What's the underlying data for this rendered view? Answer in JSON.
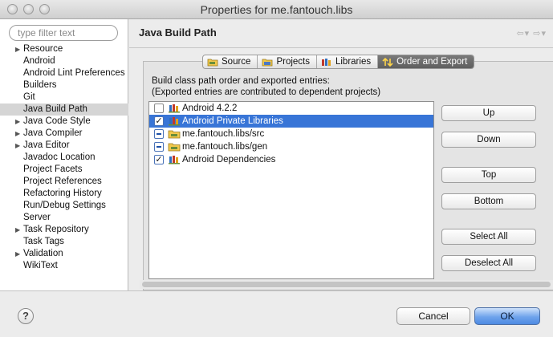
{
  "window": {
    "title": "Properties for me.fantouch.libs"
  },
  "sidebar": {
    "filter_placeholder": "type filter text",
    "items": [
      {
        "label": "Resource",
        "expandable": true
      },
      {
        "label": "Android",
        "expandable": false
      },
      {
        "label": "Android Lint Preferences",
        "expandable": false
      },
      {
        "label": "Builders",
        "expandable": false
      },
      {
        "label": "Git",
        "expandable": false
      },
      {
        "label": "Java Build Path",
        "expandable": false,
        "selected": true
      },
      {
        "label": "Java Code Style",
        "expandable": true
      },
      {
        "label": "Java Compiler",
        "expandable": true
      },
      {
        "label": "Java Editor",
        "expandable": true
      },
      {
        "label": "Javadoc Location",
        "expandable": false
      },
      {
        "label": "Project Facets",
        "expandable": false
      },
      {
        "label": "Project References",
        "expandable": false
      },
      {
        "label": "Refactoring History",
        "expandable": false
      },
      {
        "label": "Run/Debug Settings",
        "expandable": false
      },
      {
        "label": "Server",
        "expandable": false
      },
      {
        "label": "Task Repository",
        "expandable": true
      },
      {
        "label": "Task Tags",
        "expandable": false
      },
      {
        "label": "Validation",
        "expandable": true
      },
      {
        "label": "WikiText",
        "expandable": false
      }
    ]
  },
  "header": {
    "title": "Java Build Path"
  },
  "tabs": [
    {
      "label": "Source",
      "icon": "source-folder-icon"
    },
    {
      "label": "Projects",
      "icon": "projects-folder-icon"
    },
    {
      "label": "Libraries",
      "icon": "libraries-icon"
    },
    {
      "label": "Order and Export",
      "icon": "order-export-icon",
      "active": true
    }
  ],
  "order_export": {
    "description_line1": "Build class path order and exported entries:",
    "description_line2": "(Exported entries are contributed to dependent projects)",
    "entries": [
      {
        "label": "Android 4.2.2",
        "state": "unchecked",
        "icon": "library-icon"
      },
      {
        "label": "Android Private Libraries",
        "state": "checked",
        "icon": "library-icon",
        "selected": true
      },
      {
        "label": "me.fantouch.libs/src",
        "state": "partial",
        "icon": "source-folder-icon"
      },
      {
        "label": "me.fantouch.libs/gen",
        "state": "partial",
        "icon": "source-folder-icon"
      },
      {
        "label": "Android Dependencies",
        "state": "checked",
        "icon": "library-icon"
      }
    ],
    "buttons": {
      "up": "Up",
      "down": "Down",
      "top": "Top",
      "bottom": "Bottom",
      "select_all": "Select All",
      "deselect_all": "Deselect All"
    }
  },
  "footer": {
    "help_symbol": "?",
    "cancel": "Cancel",
    "ok": "OK"
  },
  "colors": {
    "selection": "#3875d7",
    "active_tab": "#6a6a6a",
    "primary_button": "#6fa3ec"
  }
}
